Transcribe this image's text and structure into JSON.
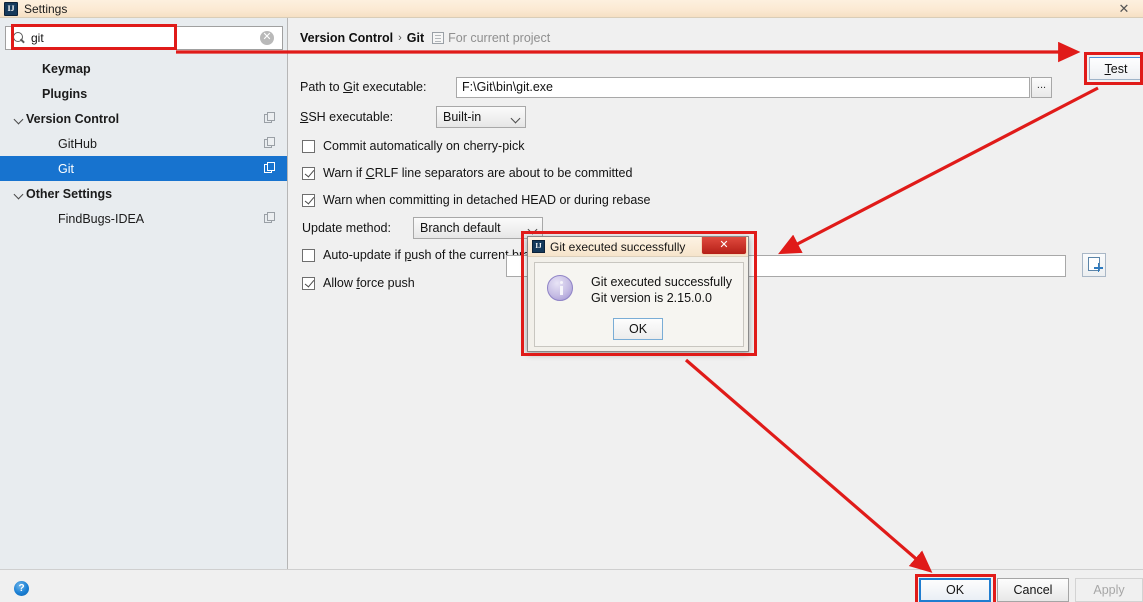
{
  "window": {
    "title": "Settings",
    "app_icon": "intellij-idea-icon",
    "close_label": "✕"
  },
  "search": {
    "value": "git",
    "placeholder": "",
    "icon": "search-icon",
    "clear_label": "✕"
  },
  "sidebar": {
    "items": [
      {
        "label": "Keymap",
        "bold": true,
        "indent": 30,
        "arrow": false,
        "selected": false,
        "copy": false
      },
      {
        "label": "Plugins",
        "bold": true,
        "indent": 30,
        "arrow": false,
        "selected": false,
        "copy": false
      },
      {
        "label": "Version Control",
        "bold": true,
        "indent": 12,
        "arrow": true,
        "selected": false,
        "copy": true
      },
      {
        "label": "GitHub",
        "bold": false,
        "indent": 46,
        "arrow": false,
        "selected": false,
        "copy": true
      },
      {
        "label": "Git",
        "bold": false,
        "indent": 46,
        "arrow": false,
        "selected": true,
        "copy": true
      },
      {
        "label": "Other Settings",
        "bold": true,
        "indent": 12,
        "arrow": true,
        "selected": false,
        "copy": false
      },
      {
        "label": "FindBugs-IDEA",
        "bold": false,
        "indent": 46,
        "arrow": false,
        "selected": false,
        "copy": true
      }
    ]
  },
  "breadcrumb": {
    "root": "Version Control",
    "separator": "›",
    "current": "Git",
    "scope_icon": "project-scope-icon",
    "scope_text": "For current project"
  },
  "settings": {
    "path_label_pre": "Path to ",
    "path_label_mn": "G",
    "path_label_post": "it executable:",
    "path_value": "F:\\Git\\bin\\git.exe",
    "browse_label": "...",
    "test_label_mn": "T",
    "test_label_post": "est",
    "ssh_label_mn": "S",
    "ssh_label_post": "SH executable:",
    "ssh_value": "Built-in",
    "update_label": "Update method:",
    "update_value": "Branch default",
    "checkboxes": [
      {
        "label_pre": "Commit automatically on cherry-pick",
        "checked": false
      },
      {
        "label_pre": "Warn if ",
        "label_mn": "C",
        "label_post": "RLF line separators are about to be committed",
        "checked": true
      },
      {
        "label_pre": "Warn when committing in detached HEAD or during rebase",
        "checked": true
      },
      {
        "label_pre": "Auto-update if ",
        "label_mn": "p",
        "label_post": "ush of the current branch was rejected",
        "checked": false
      },
      {
        "label_pre": "Allow ",
        "label_mn": "f",
        "label_post": "orce push",
        "checked": true
      }
    ],
    "add_button_icon": "add-path-icon"
  },
  "dialog": {
    "icon": "intellij-idea-icon",
    "title": "Git executed successfully",
    "close_label": "✕",
    "info_icon": "info-icon",
    "message_line1": "Git executed successfully",
    "message_line2": "Git version is 2.15.0.0",
    "ok_label": "OK"
  },
  "footer": {
    "help_icon": "help-icon",
    "help_label": "?",
    "ok_label": "OK",
    "cancel_label": "Cancel",
    "apply_label": "Apply"
  },
  "colors": {
    "annotation_red": "#e01b19",
    "selection_blue": "#1773cf",
    "titlebar": "#fbe9d2"
  }
}
